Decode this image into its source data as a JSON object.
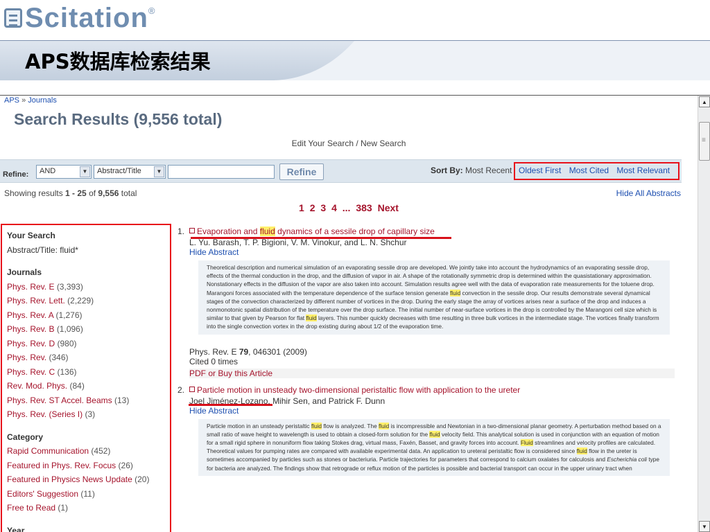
{
  "slide": {
    "logo_text": "Scitation",
    "logo_reg": "®",
    "title": "APS数据库检索结果"
  },
  "page": {
    "breadcrumb": [
      "APS",
      "Journals"
    ],
    "breadcrumb_sep": "»",
    "results_title": "Search Results (9,556 total)",
    "edit_search": "Edit Your Search / New Search",
    "refine": {
      "label": "Refine:",
      "operator": "AND",
      "field": "Abstract/Title",
      "input_value": "",
      "button": "Refine"
    },
    "sort": {
      "label": "Sort By:",
      "current": "Most Recent",
      "options": [
        "Oldest First",
        "Most Cited",
        "Most Relevant"
      ]
    },
    "showing": {
      "prefix": "Showing results ",
      "range": "1 - 25",
      "of": " of ",
      "total": "9,556",
      "suffix": " total"
    },
    "hide_all": "Hide All Abstracts",
    "pager": [
      "1",
      "2",
      "3",
      "4",
      "...",
      "383",
      "Next"
    ]
  },
  "sidebar": {
    "your_search_heading": "Your Search",
    "your_search_value": "Abstract/Title: fluid*",
    "journals_heading": "Journals",
    "journals": [
      {
        "name": "Phys. Rev. E",
        "count": "(3,393)"
      },
      {
        "name": "Phys. Rev. Lett.",
        "count": "(2,229)"
      },
      {
        "name": "Phys. Rev. A",
        "count": "(1,276)"
      },
      {
        "name": "Phys. Rev. B",
        "count": "(1,096)"
      },
      {
        "name": "Phys. Rev. D",
        "count": "(980)"
      },
      {
        "name": "Phys. Rev.",
        "count": "(346)"
      },
      {
        "name": "Phys. Rev. C",
        "count": "(136)"
      },
      {
        "name": "Rev. Mod. Phys.",
        "count": "(84)"
      },
      {
        "name": "Phys. Rev. ST Accel. Beams",
        "count": "(13)"
      },
      {
        "name": "Phys. Rev. (Series I)",
        "count": "(3)"
      }
    ],
    "category_heading": "Category",
    "categories": [
      {
        "name": "Rapid Communication",
        "count": "(452)"
      },
      {
        "name": "Featured in Phys. Rev. Focus",
        "count": "(26)"
      },
      {
        "name": "Featured in Physics News Update",
        "count": "(20)"
      },
      {
        "name": "Editors' Suggestion",
        "count": "(11)"
      },
      {
        "name": "Free to Read",
        "count": "(1)"
      }
    ],
    "year_heading": "Year"
  },
  "results": [
    {
      "num": "1.",
      "title_pre": "Evaporation and ",
      "title_hl": "fluid",
      "title_post": " dynamics of a sessile drop of capillary size",
      "authors": "L. Yu. Barash, T. P. Bigioni, V. M. Vinokur, and L. N. Shchur",
      "hide_abstract": "Hide Abstract",
      "abstract_a": "Theoretical description and numerical simulation of an evaporating sessile drop are developed. We jointly take into account the hydrodynamics of an evaporating sessile drop, effects of the thermal conduction in the drop, and the diffusion of vapor in air. A shape of the rotationally symmetric drop is determined within the quasistationary approximation. Nonstationary effects in the diffusion of the vapor are also taken into account. Simulation results agree well with the data of evaporation rate measurements for the toluene drop. Marangoni forces associated with the temperature dependence of the surface tension generate ",
      "abstract_hl1": "fluid",
      "abstract_b": " convection in the sessile drop. Our results demonstrate several dynamical stages of the convection characterized by different number of vortices in the drop. During the early stage the array of vortices arises near a surface of the drop and induces a nonmonotonic spatial distribution of the temperature over the drop surface. The initial number of near-surface vortices in the drop is controlled by the Marangoni cell size which is similar to that given by Pearson for flat ",
      "abstract_hl2": "fluid",
      "abstract_c": " layers. This number quickly decreases with time resulting in three bulk vortices in the intermediate stage. The vortices finally transform into the single convection vortex in the drop existing during about 1/2 of the evaporation time.",
      "journal_pre": "Phys. Rev. E ",
      "volume": "79",
      "journal_post": ", 046301 (2009)",
      "cited": "Cited 0 times",
      "pdf": "PDF or Buy this Article"
    },
    {
      "num": "2.",
      "title": "Particle motion in unsteady two-dimensional peristaltic flow with application to the ureter",
      "authors": "Joel Jiménez-Lozano, Mihir Sen, and Patrick F. Dunn",
      "hide_abstract": "Hide Abstract",
      "abstract_a": "Particle motion in an unsteady peristaltic ",
      "abstract_hl1": "fluid",
      "abstract_b": " flow is analyzed. The ",
      "abstract_hl2": "fluid",
      "abstract_c": " is incompressible and Newtonian in a two-dimensional planar geometry. A perturbation method based on a small ratio of wave height to wavelength is used to obtain a closed-form solution for the ",
      "abstract_hl3": "fluid",
      "abstract_d": " velocity field. This analytical solution is used in conjunction with an equation of motion for a small rigid sphere in nonuniform flow taking Stokes drag, virtual mass, Faxén, Basset, and gravity forces into account. ",
      "abstract_hl4": "Fluid",
      "abstract_e": " streamlines and velocity profiles are calculated. Theoretical values for pumping rates are compared with available experimental data. An application to ureteral peristaltic flow is considered since ",
      "abstract_hl5": "fluid",
      "abstract_f": " flow in the ureter is sometimes accompanied by particles such as stones or bacteriuria. Particle trajectories for parameters that correspond to calcium oxalates for calculosis and ",
      "abstract_italic": "Escherichia coli",
      "abstract_g": " type for bacteria are analyzed. The findings show that retrograde or reflux motion of the particles is possible and bacterial transport can occur in the upper urinary tract when"
    }
  ],
  "colors": {
    "link": "#a5132b",
    "blue_link": "#1d4fb0",
    "highlight": "#fff06a",
    "annotation": "#e8101a",
    "banner": "#ccd6e4"
  }
}
